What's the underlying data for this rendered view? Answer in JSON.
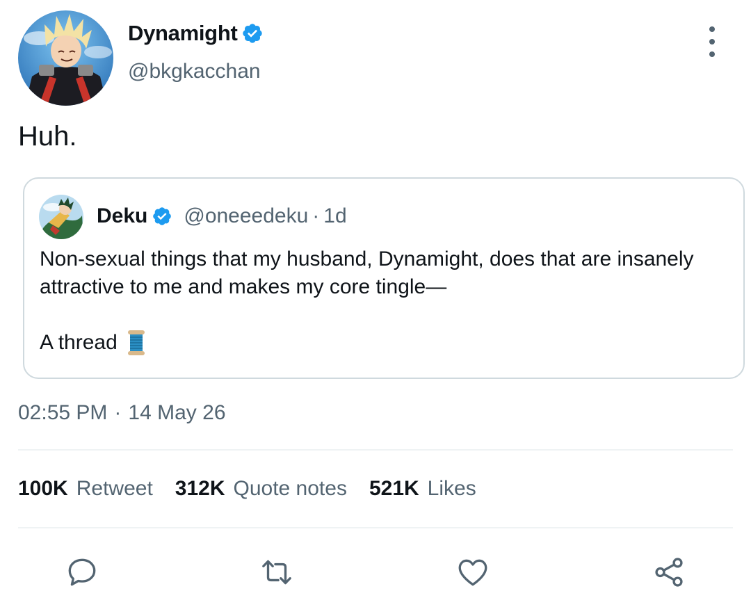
{
  "tweet": {
    "author": {
      "name": "Dynamight",
      "handle": "@bkgkacchan",
      "verified": true
    },
    "text": "Huh.",
    "timestamp": {
      "time": "02:55 PM",
      "separator": "·",
      "date": "14 May 26"
    }
  },
  "quote": {
    "author": {
      "name": "Deku",
      "handle": "@oneeedeku",
      "verified": true
    },
    "separator": "·",
    "age": "1d",
    "lines": [
      "Non-sexual things that my husband, Dynamight, does that are insanely attractive to me and makes my core tingle—"
    ],
    "thread_label": "A thread",
    "thread_emoji_icon": "spool-of-thread-icon"
  },
  "stats": [
    {
      "count": "100K",
      "label": "Retweet"
    },
    {
      "count": "312K",
      "label": "Quote notes"
    },
    {
      "count": "521K",
      "label": "Likes"
    }
  ],
  "actions": {
    "reply_icon": "reply-bubble-icon",
    "retweet_icon": "retweet-icon",
    "like_icon": "heart-icon",
    "share_icon": "share-icon"
  },
  "colors": {
    "verified_blue": "#1d9bf0",
    "secondary_text": "#536471",
    "border": "#cfd9de"
  }
}
